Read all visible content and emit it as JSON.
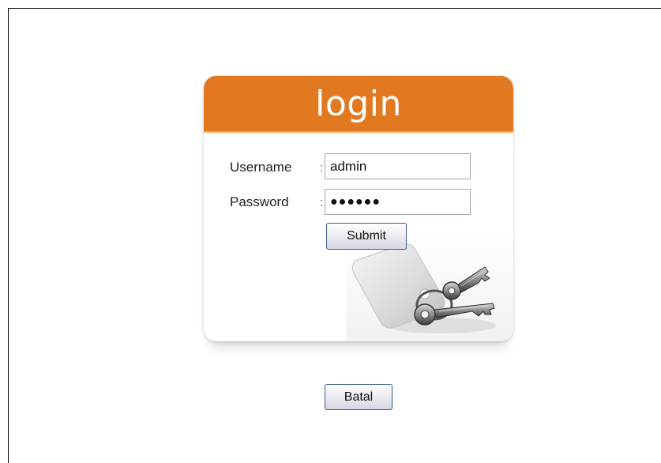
{
  "login": {
    "title": "login",
    "username_label": "Username",
    "password_label": "Password",
    "colon": ":",
    "username_value": "admin",
    "password_value": "●●●●●●",
    "submit_label": "Submit"
  },
  "footer": {
    "cancel_label": "Batal"
  },
  "colors": {
    "header_orange": "#e27820",
    "button_border": "#3c5b8f",
    "input_border": "#9ba7b5"
  },
  "icons": {
    "illustration": "keys-with-tag-icon"
  }
}
